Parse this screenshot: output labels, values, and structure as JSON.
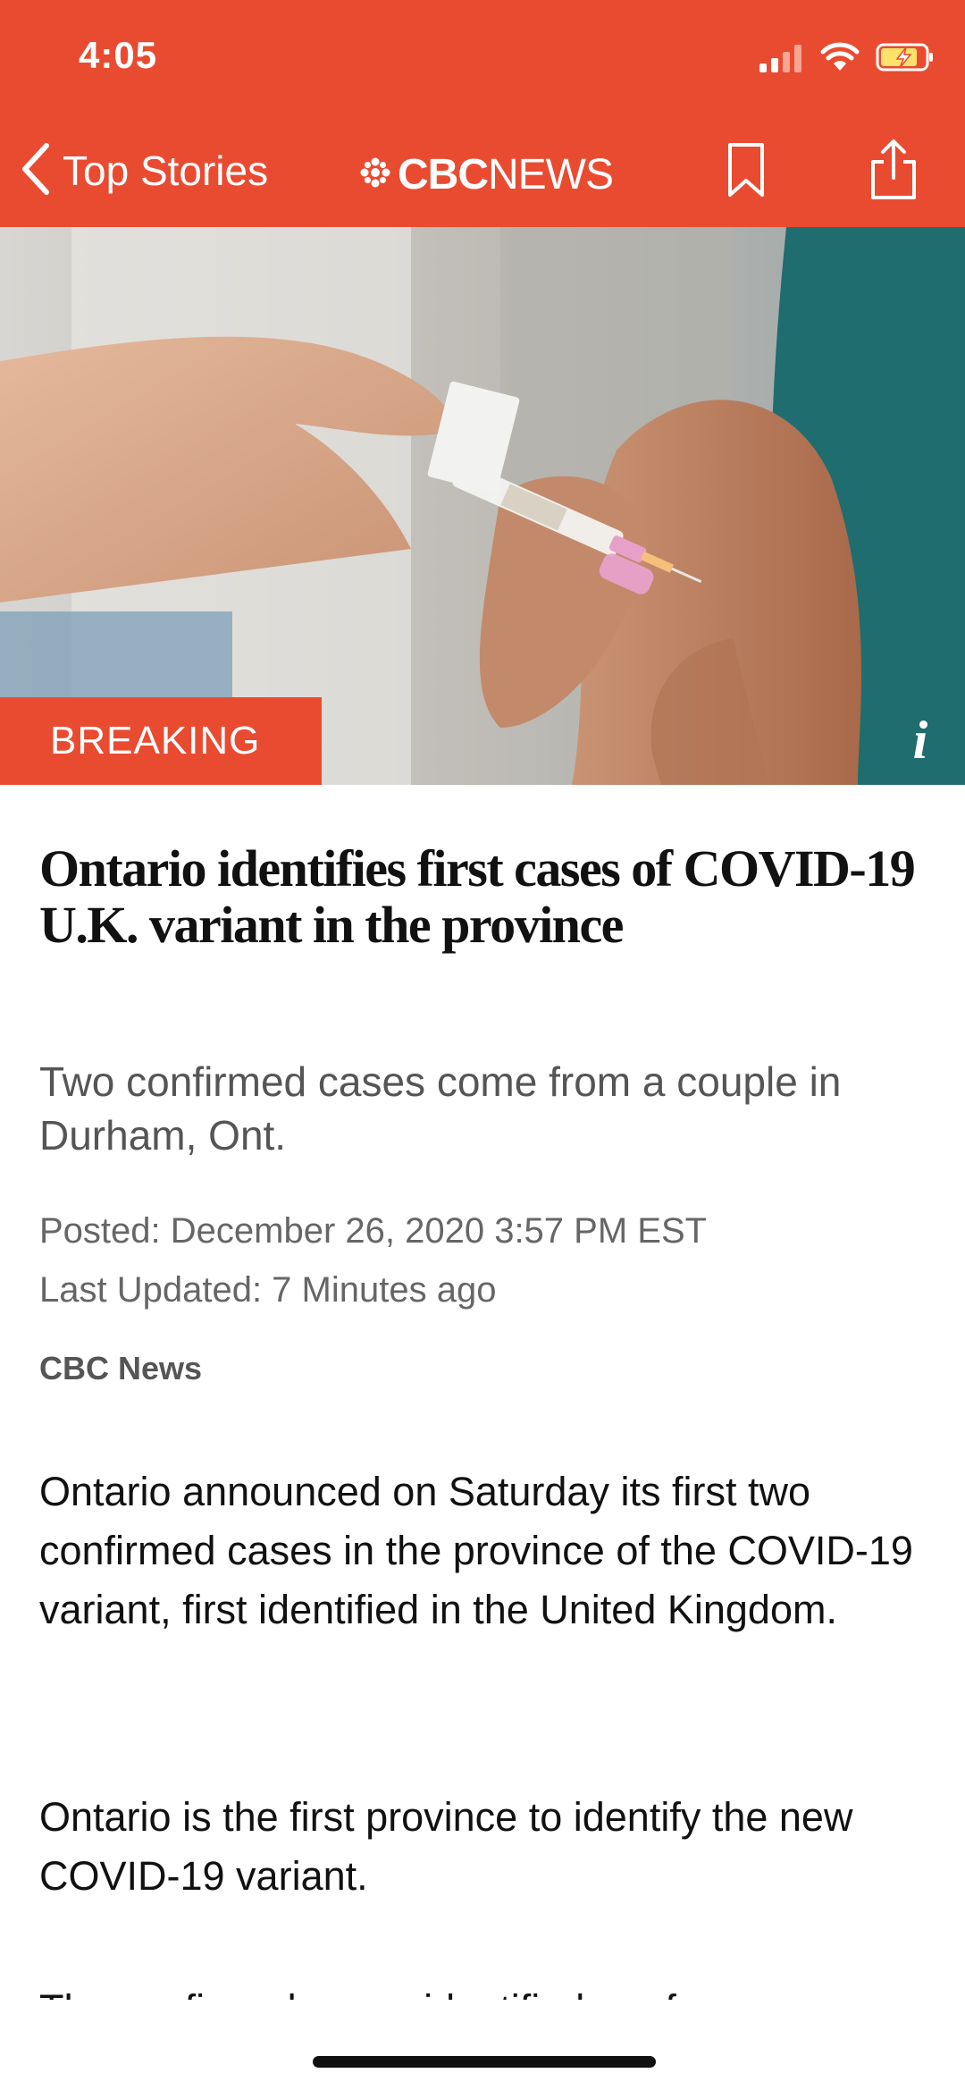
{
  "colors": {
    "accent": "#e94b31",
    "text": "#111111",
    "subtle": "#555555"
  },
  "status_bar": {
    "time": "4:05",
    "icons": [
      "cellular-signal-icon",
      "wifi-icon",
      "battery-charging-icon"
    ]
  },
  "nav": {
    "back_label": "Top Stories",
    "brand_bold": "CBC",
    "brand_light": "NEWS",
    "icons": [
      "chevron-left-icon",
      "cbc-gem-icon",
      "bookmark-icon",
      "share-icon"
    ]
  },
  "hero": {
    "badge": "BREAKING",
    "info_label": "i"
  },
  "article": {
    "headline": "Ontario identifies first cases of COVID-19 U.K. variant in the province",
    "subhead": "Two confirmed cases come from a couple in Durham, Ont.",
    "posted": "Posted: December 26, 2020 3:57 PM EST",
    "updated": "Last Updated: 7 Minutes ago",
    "byline": "CBC News",
    "paragraphs": [
      "Ontario announced on Saturday its first two confirmed cases in the province of the COVID-19 variant, first identified in the United Kingdom.",
      "Ontario is the first province to identify the new COVID-19 variant.",
      "The confirmed cases identified are from"
    ]
  }
}
